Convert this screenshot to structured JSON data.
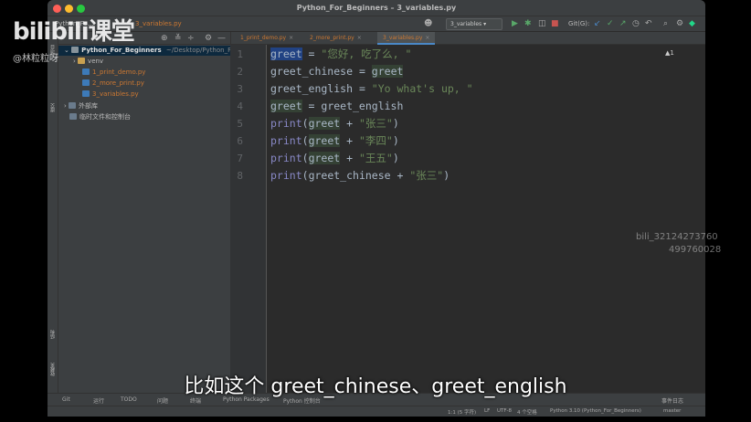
{
  "window": {
    "title": "Python_For_Beginners – 3_variables.py"
  },
  "navbar": {
    "project": "Python_Fo...",
    "file": "3_variables.py",
    "run_config": "3_variables",
    "git_label": "Git(G):"
  },
  "project_panel": {
    "root_name": "Python_For_Beginners",
    "root_path": "~/Desktop/Python_Fo",
    "venv": "venv",
    "files": [
      "1_print_demo.py",
      "2_more_print.py",
      "3_variables.py"
    ],
    "external_libs": "外部库",
    "scratches": "临时文件和控制台"
  },
  "sidebar_strip": {
    "project": "项目",
    "commit": "提交",
    "structure": "结构",
    "bookmarks": "收藏夹"
  },
  "tabs": [
    {
      "label": "1_print_demo.py"
    },
    {
      "label": "2_more_print.py"
    },
    {
      "label": "3_variables.py"
    }
  ],
  "editor": {
    "warning_count": "▲1",
    "line_numbers": [
      "1",
      "2",
      "3",
      "4",
      "5",
      "6",
      "7",
      "8"
    ]
  },
  "code": {
    "l1_var": "greet",
    "l1_eq": " = ",
    "l1_str": "\"您好, 吃了么, \"",
    "l2_var": "greet_chinese",
    "l2_eq": " = ",
    "l2_val": "greet",
    "l3_var": "greet_english",
    "l3_eq": " = ",
    "l3_str": "\"Yo what's up, \"",
    "l4_var": "greet",
    "l4_rest": " = greet_english",
    "print": "print",
    "open": "(",
    "plus": " + ",
    "close": ")",
    "greet": "greet",
    "greet_chinese": "greet_chinese",
    "s5": "\"张三\"",
    "s6": "\"李四\"",
    "s7": "\"王五\"",
    "s8": "\"张三\""
  },
  "toolwindows": [
    "Git",
    "运行",
    "TODO",
    "问题",
    "终端",
    "Python Packages",
    "Python 控制台"
  ],
  "event_log": "事件日志",
  "status": {
    "position": "1:1 (5 字符)",
    "line_sep": "LF",
    "encoding": "UTF-8",
    "indent": "4 个空格",
    "interpreter": "Python 3.10 (Python_For_Beginners)",
    "branch": "master"
  },
  "overlay": {
    "logo": "bilibili课堂",
    "user": "@林粒粒呀",
    "watermark_id": "bili_32124273760",
    "watermark_num": "499760028",
    "subtitle": "比如这个 greet_chinese、greet_english"
  },
  "colors": {
    "string": "#6a8759",
    "builtin": "#8888c6",
    "identifier": "#a9b7c6",
    "accent": "#4a88c7"
  }
}
